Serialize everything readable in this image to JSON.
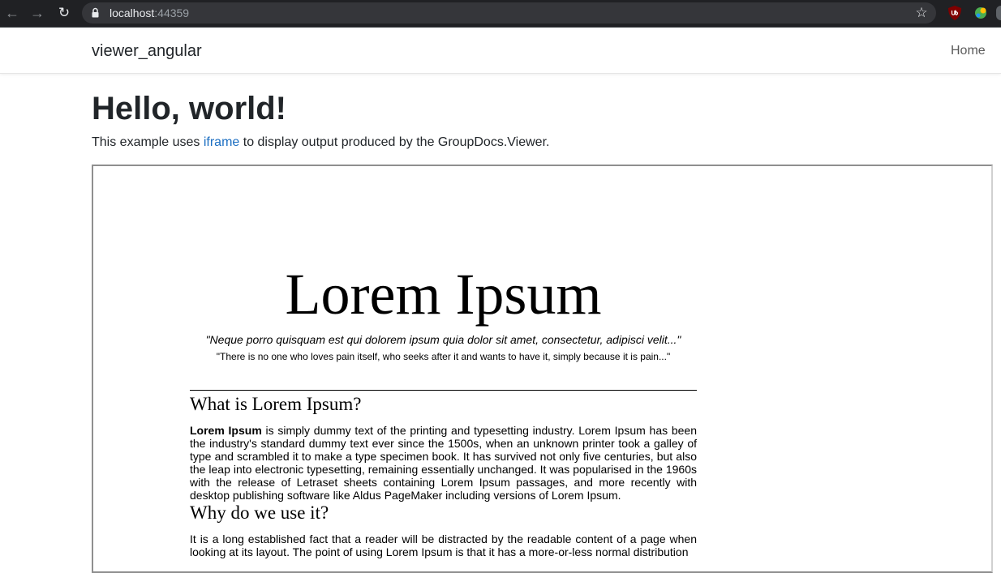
{
  "browser": {
    "url_host": "localhost",
    "url_port": ":44359",
    "back_glyph": "←",
    "forward_glyph": "→",
    "reload_glyph": "↻",
    "star_glyph": "☆"
  },
  "navbar": {
    "brand": "viewer_angular",
    "home_link": "Home"
  },
  "page": {
    "heading": "Hello, world!",
    "intro_before": "This example uses ",
    "intro_link": "iframe",
    "intro_after": " to display output produced by the GroupDocs.Viewer."
  },
  "document": {
    "title": "Lorem Ipsum",
    "quote_latin": "\"Neque porro quisquam est qui dolorem ipsum quia dolor sit amet, consectetur, adipisci velit...\"",
    "quote_english": "\"There is no one who loves pain itself, who seeks after it and wants to have it, simply because it is pain...\"",
    "section1_heading": "What is Lorem Ipsum?",
    "section1_bold": "Lorem Ipsum",
    "section1_text": " is simply dummy text of the printing and typesetting industry. Lorem Ipsum has been the industry's standard dummy text ever since the 1500s, when an unknown printer took a galley of type and scrambled it to make a type specimen book. It has survived not only five centuries, but also the leap into electronic typesetting, remaining essentially unchanged. It was popularised in the 1960s with the release of Letraset sheets containing Lorem Ipsum passages, and more recently with desktop publishing software like Aldus PageMaker including versions of Lorem Ipsum.",
    "section2_heading": "Why do we use it?",
    "section2_text": "It is a long established fact that a reader will be distracted by the readable content of a page when looking at its layout. The point of using Lorem Ipsum is that it has a more-or-less normal distribution"
  },
  "colors": {
    "chrome_bg": "#202124",
    "omnibox_bg": "#35363a",
    "link": "#1b6ec2"
  }
}
